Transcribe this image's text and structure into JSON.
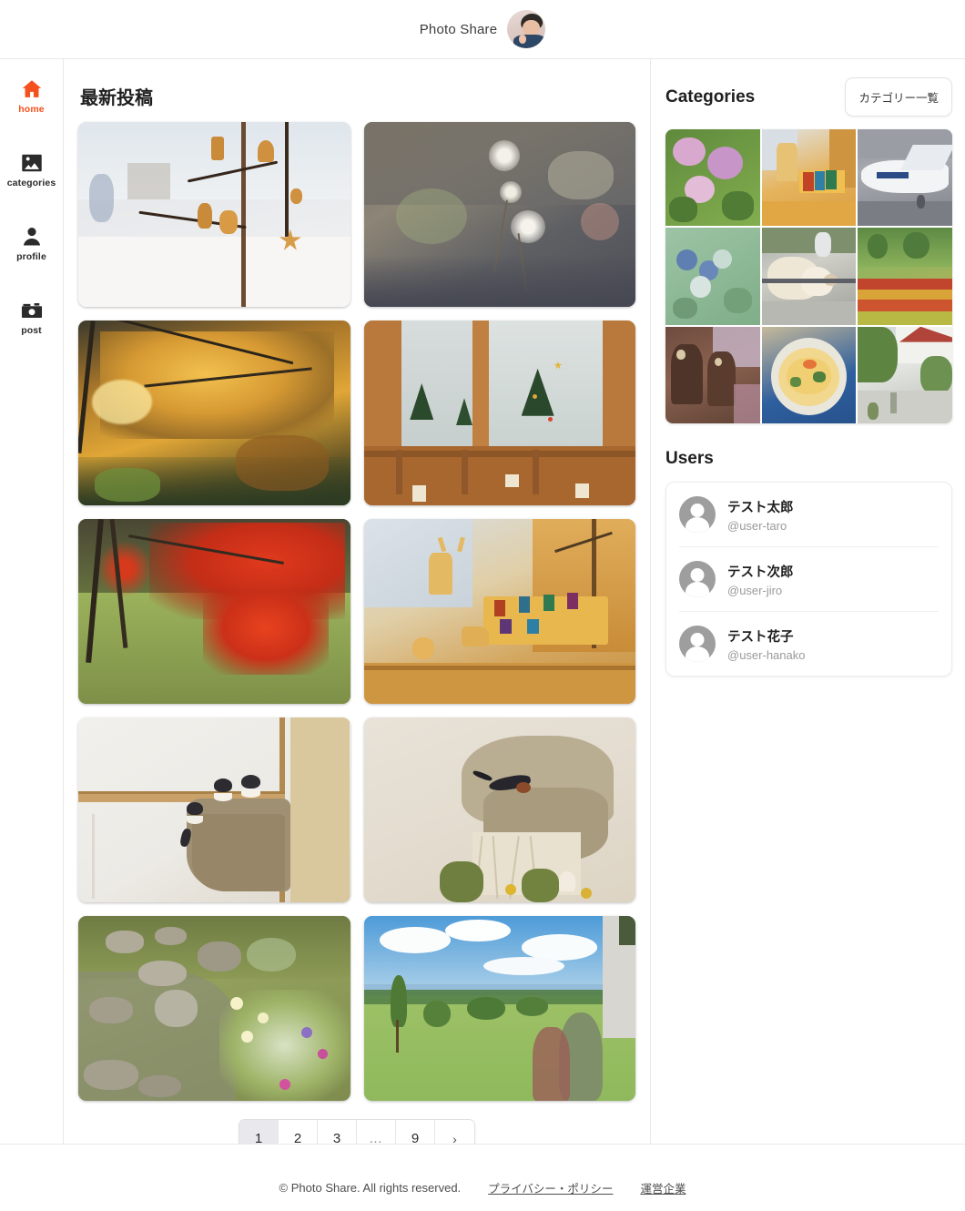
{
  "header": {
    "brand_title": "Photo Share",
    "avatar_name": "user-avatar"
  },
  "sidebar": {
    "items": [
      {
        "label": "home",
        "icon": "home-icon",
        "active": true
      },
      {
        "label": "categories",
        "icon": "image-icon",
        "active": false
      },
      {
        "label": "profile",
        "icon": "person-icon",
        "active": false
      },
      {
        "label": "post",
        "icon": "camera-icon",
        "active": false
      }
    ],
    "active_color": "#f4511e"
  },
  "feed": {
    "title": "最新投稿",
    "photos": [
      {
        "alt": "wooden ornaments hanging on branch display"
      },
      {
        "alt": "dandelion seed heads close-up"
      },
      {
        "alt": "golden autumn maple leaves backlit"
      },
      {
        "alt": "wooden christmas trees on window sill"
      },
      {
        "alt": "red maple leaves over green grass"
      },
      {
        "alt": "wooden toy deer and colorful blocks"
      },
      {
        "alt": "swallow chicks in mud nest"
      },
      {
        "alt": "swallow perched on nest"
      },
      {
        "alt": "rocky stream with wildflowers"
      },
      {
        "alt": "green meadow under blue sky"
      }
    ]
  },
  "pagination": {
    "pages": [
      "1",
      "2",
      "3",
      "…",
      "9"
    ],
    "current": "1",
    "next_label": "›"
  },
  "categories": {
    "title": "Categories",
    "button_label": "カテゴリー一覧",
    "tiles": [
      {
        "alt": "pink hydrangea flowers"
      },
      {
        "alt": "wooden toy deer and color blocks"
      },
      {
        "alt": "airplane at airport gate"
      },
      {
        "alt": "blueberries on branch"
      },
      {
        "alt": "sheep at fence"
      },
      {
        "alt": "tulip flower garden park"
      },
      {
        "alt": "shisa lion statues"
      },
      {
        "alt": "pasta dish on plate"
      },
      {
        "alt": "white building with trees street"
      }
    ]
  },
  "users": {
    "title": "Users",
    "list": [
      {
        "name": "テスト太郎",
        "handle": "@user-taro"
      },
      {
        "name": "テスト次郎",
        "handle": "@user-jiro"
      },
      {
        "name": "テスト花子",
        "handle": "@user-hanako"
      }
    ]
  },
  "footer": {
    "copyright": "© Photo Share. All rights reserved.",
    "links": [
      "プライバシー・ポリシー",
      "運営企業"
    ]
  }
}
